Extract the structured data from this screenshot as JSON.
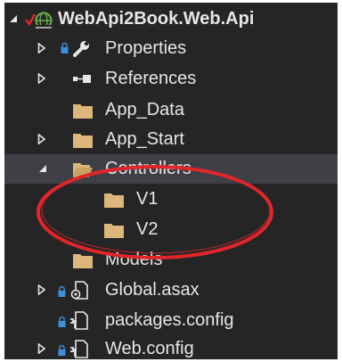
{
  "solution_explorer": {
    "project": {
      "label": "WebApi2Book.Web.Api",
      "icon": "csharp-web-project-icon"
    },
    "items": [
      {
        "label": "Properties",
        "icon": "wrench-icon",
        "expander": "collapsed"
      },
      {
        "label": "References",
        "icon": "references-icon",
        "expander": "collapsed"
      },
      {
        "label": "App_Data",
        "icon": "folder-icon",
        "expander": "none"
      },
      {
        "label": "App_Start",
        "icon": "folder-icon",
        "expander": "collapsed"
      },
      {
        "label": "Controllers",
        "icon": "folder-open-icon",
        "expander": "expanded",
        "selected": true
      },
      {
        "label": "V1",
        "icon": "folder-icon",
        "expander": "none"
      },
      {
        "label": "V2",
        "icon": "folder-icon",
        "expander": "none"
      },
      {
        "label": "Models",
        "icon": "folder-icon",
        "expander": "none"
      },
      {
        "label": "Global.asax",
        "icon": "config-gear-file-icon",
        "expander": "collapsed"
      },
      {
        "label": "packages.config",
        "icon": "config-file-icon",
        "expander": "none"
      },
      {
        "label": "Web.config",
        "icon": "config-file-icon",
        "expander": "collapsed"
      }
    ]
  },
  "colors": {
    "background": "#252526",
    "selected_row": "#3f3f46",
    "text": "#e6e6e6",
    "folder": "#dcb67a",
    "highlight_ellipse": "#e0262a",
    "lock_badge": "#3e8ede"
  }
}
